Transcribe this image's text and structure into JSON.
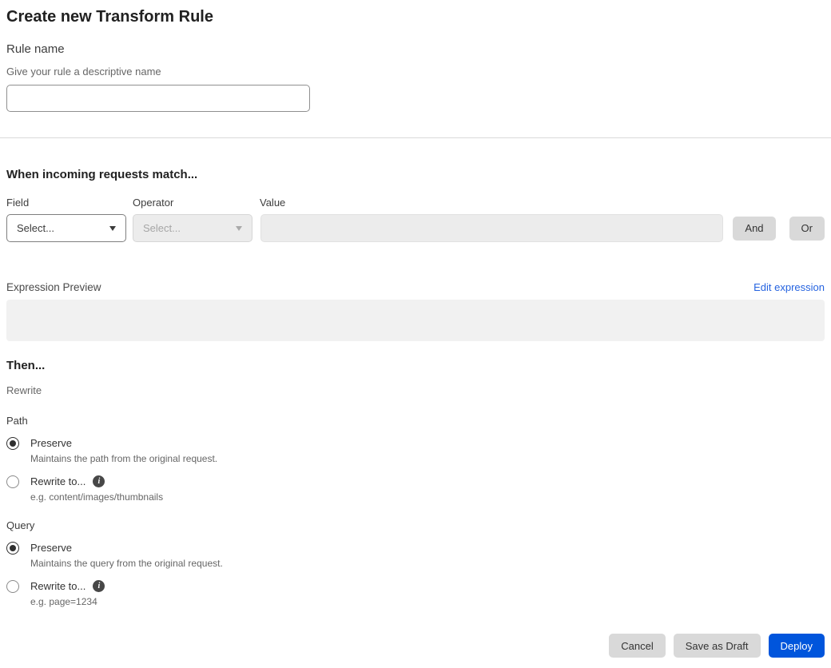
{
  "page": {
    "title": "Create new Transform Rule"
  },
  "rule_name": {
    "label": "Rule name",
    "helper": "Give your rule a descriptive name",
    "value": "",
    "placeholder": ""
  },
  "match": {
    "heading": "When incoming requests match...",
    "field": {
      "label": "Field",
      "selected": "Select...",
      "disabled": false
    },
    "operator": {
      "label": "Operator",
      "selected": "Select...",
      "disabled": true
    },
    "value": {
      "label": "Value",
      "value": "",
      "placeholder": "",
      "disabled": true
    },
    "and_button": "And",
    "or_button": "Or"
  },
  "expression": {
    "label": "Expression Preview",
    "edit_link": "Edit expression",
    "content": ""
  },
  "then": {
    "heading": "Then...",
    "action": "Rewrite",
    "path": {
      "label": "Path",
      "options": [
        {
          "label": "Preserve",
          "helper": "Maintains the path from the original request.",
          "selected": true,
          "has_info": false
        },
        {
          "label": "Rewrite to...",
          "helper": "e.g. content/images/thumbnails",
          "selected": false,
          "has_info": true
        }
      ]
    },
    "query": {
      "label": "Query",
      "options": [
        {
          "label": "Preserve",
          "helper": "Maintains the query from the original request.",
          "selected": true,
          "has_info": false
        },
        {
          "label": "Rewrite to...",
          "helper": "e.g. page=1234",
          "selected": false,
          "has_info": true
        }
      ]
    }
  },
  "footer": {
    "cancel": "Cancel",
    "save_draft": "Save as Draft",
    "deploy": "Deploy"
  },
  "icons": {
    "select_caret": "chevron-down",
    "info_glyph": "i"
  },
  "colors": {
    "accent_blue": "#0055dc",
    "link_blue": "#2563e0",
    "disabled_bg": "#ececec",
    "btn_gray": "#d9d9d9"
  }
}
